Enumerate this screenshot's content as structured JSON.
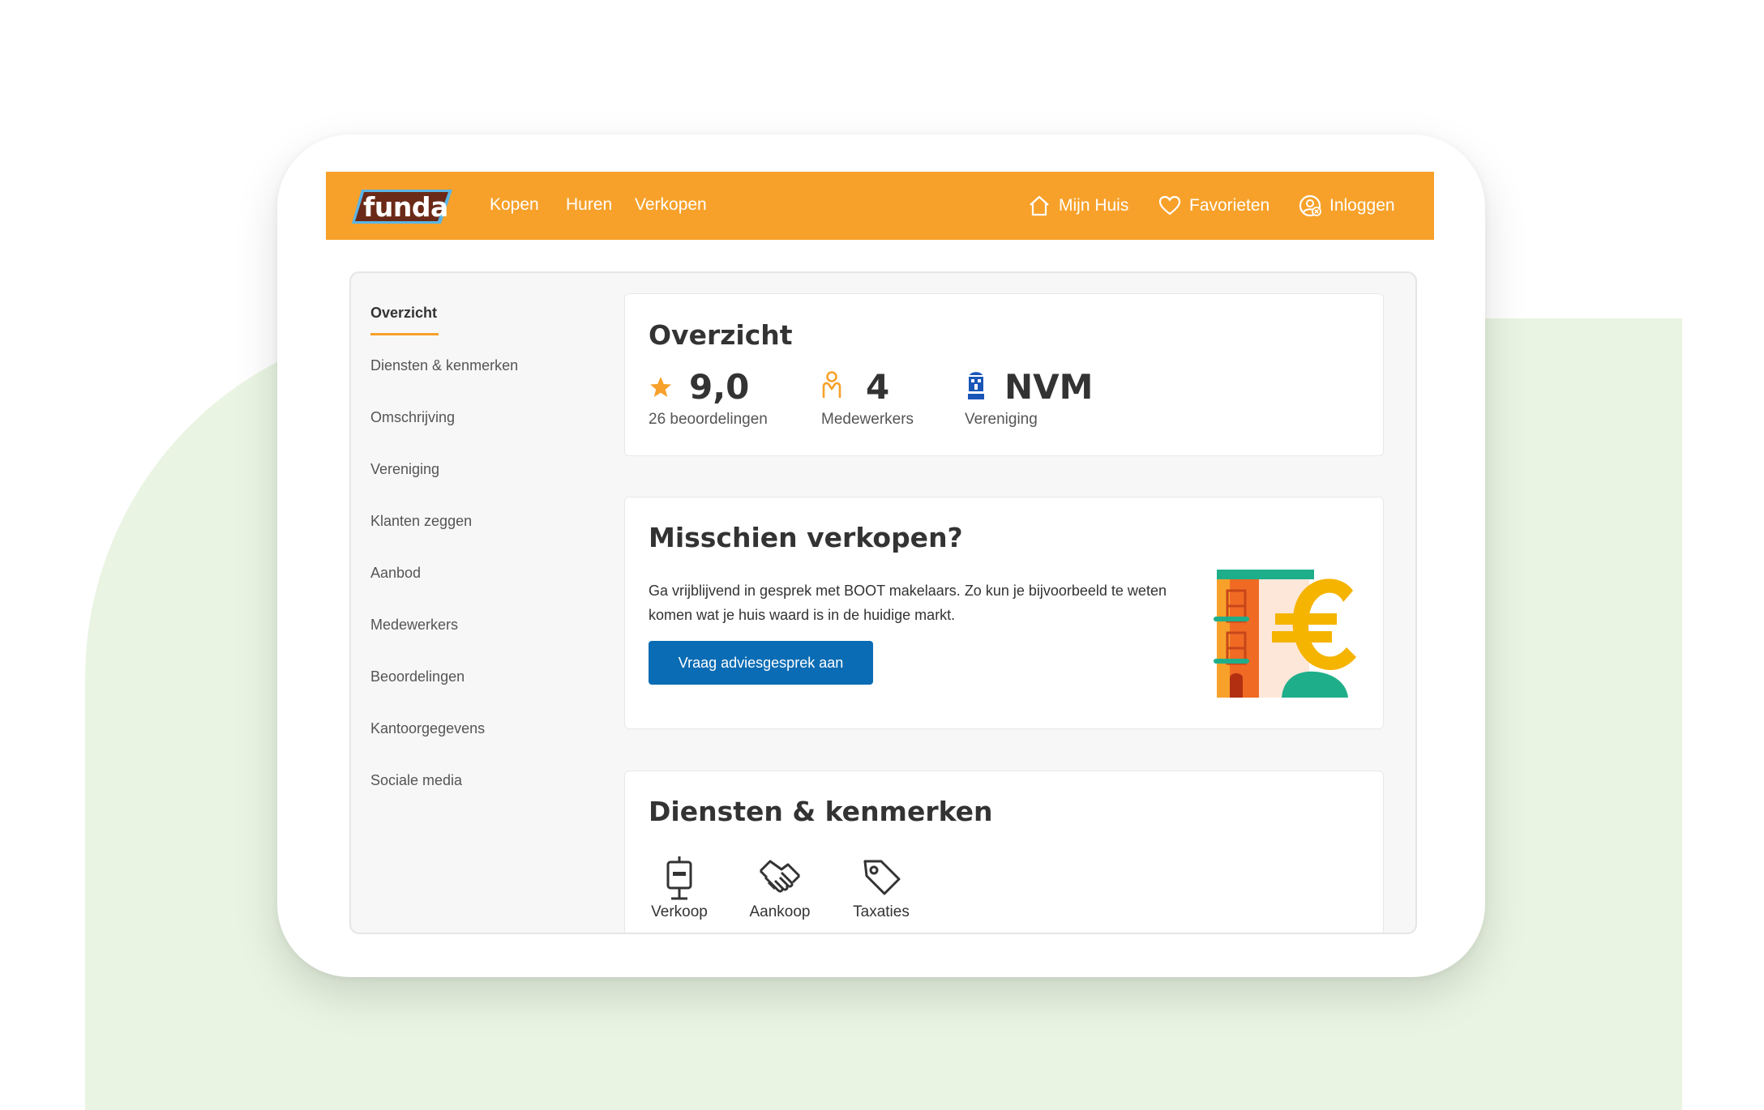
{
  "header": {
    "logo_text": "funda",
    "nav": [
      "Kopen",
      "Huren",
      "Verkopen"
    ],
    "mijn_huis": "Mijn Huis",
    "favorieten": "Favorieten",
    "inloggen": "Inloggen",
    "accent_color": "#f7a12a"
  },
  "sidebar": {
    "items": [
      "Overzicht",
      "Diensten & kenmerken",
      "Omschrijving",
      "Vereniging",
      "Klanten zeggen",
      "Aanbod",
      "Medewerkers",
      "Beoordelingen",
      "Kantoorgegevens",
      "Sociale media"
    ],
    "active": "Overzicht"
  },
  "overview": {
    "title": "Overzicht",
    "rating": {
      "value": "9,0",
      "label": "26 beoordelingen",
      "icon": "star-icon"
    },
    "employees": {
      "value": "4",
      "label": "Medewerkers",
      "icon": "person-icon"
    },
    "association": {
      "value": "NVM",
      "label": "Vereniging",
      "icon": "nvm-logo-icon"
    }
  },
  "sell": {
    "title": "Misschien verkopen?",
    "text": "Ga vrijblijvend in gesprek met BOOT makelaars. Zo kun je bijvoorbeeld te weten komen wat je huis waard is in de huidige markt.",
    "button": "Vraag adviesgesprek aan",
    "button_color": "#0a6cb4"
  },
  "services": {
    "title": "Diensten & kenmerken",
    "items": [
      {
        "label": "Verkoop",
        "icon": "for-sale-sign-icon"
      },
      {
        "label": "Aankoop",
        "icon": "handshake-icon"
      },
      {
        "label": "Taxaties",
        "icon": "price-tag-icon"
      }
    ]
  }
}
